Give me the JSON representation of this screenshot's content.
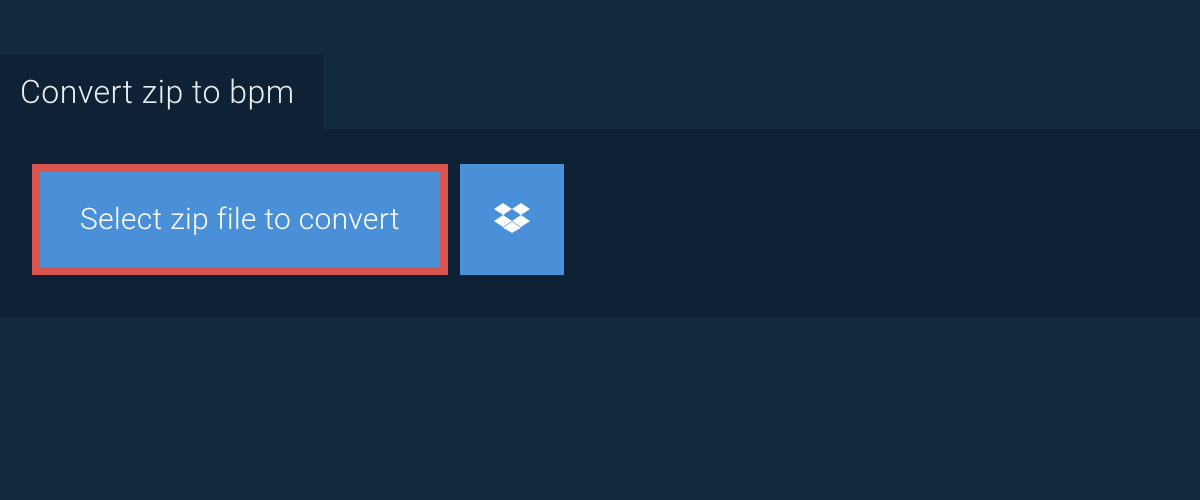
{
  "tab": {
    "title": "Convert zip to bpm"
  },
  "actions": {
    "select_file_label": "Select zip file to convert"
  },
  "colors": {
    "background": "#13293d",
    "panel": "#0e2135",
    "button": "#4a90d9",
    "border_highlight": "#d9534f"
  }
}
